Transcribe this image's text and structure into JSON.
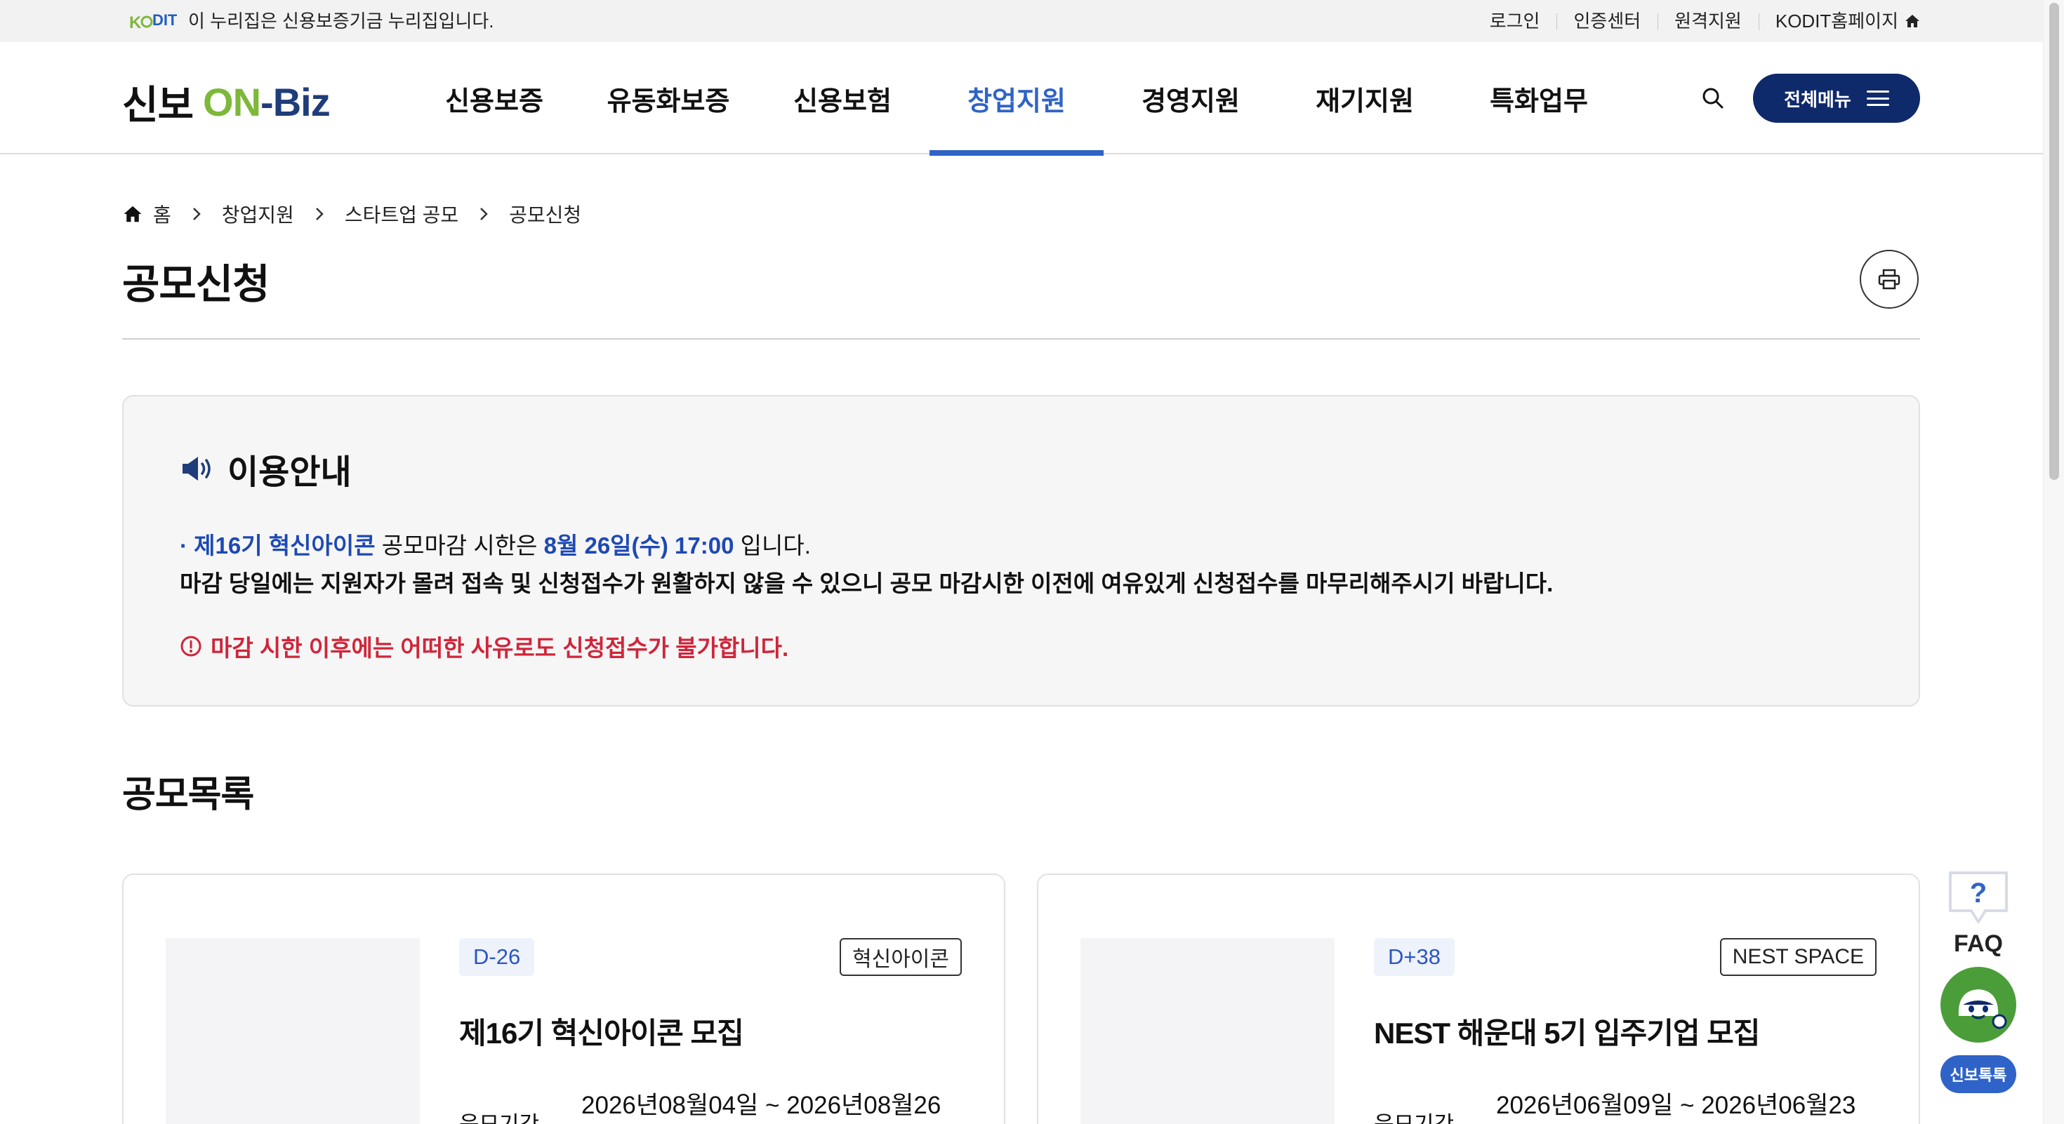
{
  "topbar": {
    "logo_text": "KODIT",
    "notice": "이 누리집은 신용보증기금 누리집입니다.",
    "links": [
      "로그인",
      "인증센터",
      "원격지원",
      "KODIT홈페이지"
    ]
  },
  "header": {
    "logo": {
      "part1": "신보",
      "part2": "ON",
      "part3": "-Biz"
    },
    "nav": [
      "신용보증",
      "유동화보증",
      "신용보험",
      "창업지원",
      "경영지원",
      "재기지원",
      "특화업무"
    ],
    "active_nav": "창업지원",
    "all_menu_label": "전체메뉴"
  },
  "breadcrumb": [
    "홈",
    "창업지원",
    "스타트업 공모",
    "공모신청"
  ],
  "page_title": "공모신청",
  "notice": {
    "title": "이용안내",
    "line1_prefix": "· 제16기 혁신아이콘",
    "line1_mid": " 공모마감 시한은 ",
    "line1_deadline": "8월 26일(수) 17:00",
    "line1_suffix": " 입니다.",
    "line2": "마감 당일에는 지원자가 몰려 접속 및 신청접수가 원활하지 않을 수 있으니 공모 마감시한 이전에 여유있게 신청접수를 마무리해주시기 바랍니다.",
    "warning": "마감 시한 이후에는 어떠한 사유로도 신청접수가 불가합니다."
  },
  "section_title": "공모목록",
  "cards": [
    {
      "dday": "D-26",
      "tag": "혁신아이콘",
      "title": "제16기 혁신아이콘 모집",
      "period_label": "응모기간",
      "period": "2026년08월04일 ~ 2026년08월26"
    },
    {
      "dday": "D+38",
      "tag": "NEST SPACE",
      "title": "NEST 해운대 5기 입주기업 모집",
      "period_label": "응모기간",
      "period": "2026년06월09일 ~ 2026년06월23"
    }
  ],
  "quick": {
    "faq": "FAQ",
    "chatbot": "신보톡톡"
  },
  "colors": {
    "primary": "#2f63c7",
    "navy": "#0f2a6b",
    "warning": "#d0253a",
    "logo_green": "#7db83a"
  }
}
